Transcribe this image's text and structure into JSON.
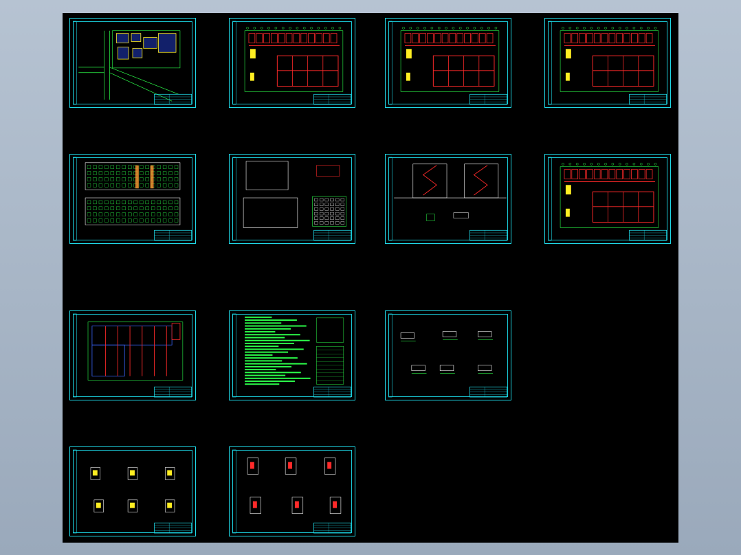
{
  "viewer": {
    "canvas_background": "#000000",
    "frame_color": "#1fd8e6",
    "line_colors": {
      "wall": "#ff2a2a",
      "dimension": "#2cff4a",
      "text": "#2cff4a",
      "frame": "#1fd8e6",
      "fill": "#ffee22",
      "grid": "#ffffff"
    }
  },
  "sheets": [
    {
      "id": "site-plan",
      "kind": "site"
    },
    {
      "id": "ground-floor-plan",
      "kind": "plan"
    },
    {
      "id": "second-floor-plan",
      "kind": "plan"
    },
    {
      "id": "third-floor-plan",
      "kind": "plan"
    },
    {
      "id": "front-rear-elevations",
      "kind": "elevation"
    },
    {
      "id": "side-elevations",
      "kind": "side"
    },
    {
      "id": "sections",
      "kind": "section"
    },
    {
      "id": "fourth-floor-plan",
      "kind": "plan"
    },
    {
      "id": "roof-plan",
      "kind": "roof"
    },
    {
      "id": "design-notes",
      "kind": "notes"
    },
    {
      "id": "node-details-1",
      "kind": "details"
    },
    {
      "id": "node-details-2",
      "kind": "details2"
    },
    {
      "id": "node-details-3",
      "kind": "details3"
    }
  ]
}
